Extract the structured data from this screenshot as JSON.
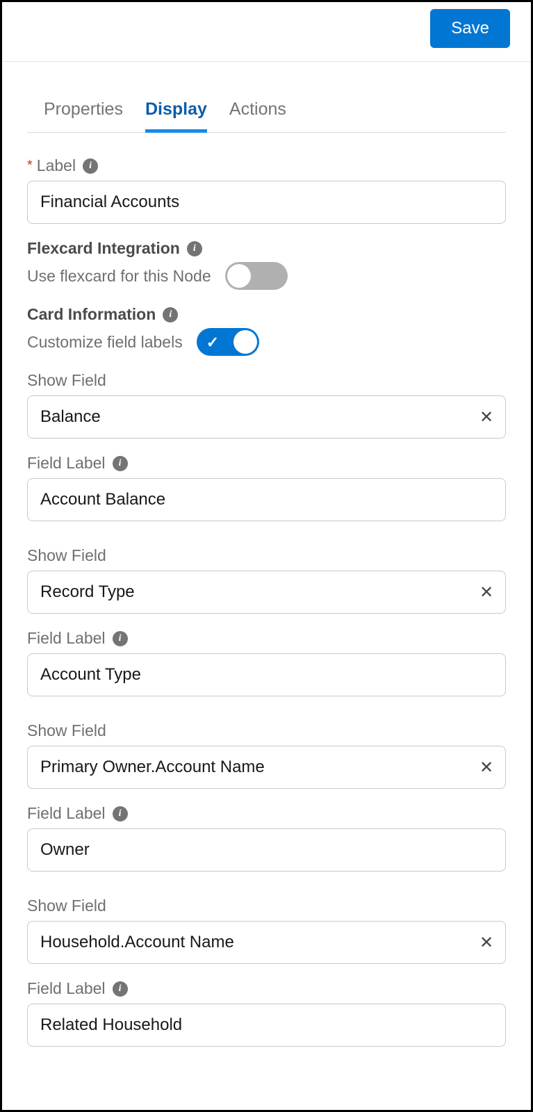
{
  "header": {
    "save": "Save"
  },
  "tabs": {
    "properties": "Properties",
    "display": "Display",
    "actions": "Actions"
  },
  "label": {
    "title": "Label",
    "value": "Financial Accounts"
  },
  "flexcard": {
    "section": "Flexcard Integration",
    "toggle_label": "Use flexcard for this Node"
  },
  "cardinfo": {
    "section": "Card Information",
    "toggle_label": "Customize field labels"
  },
  "fieldLabels": {
    "show_field": "Show Field",
    "field_label": "Field Label"
  },
  "pairs": [
    {
      "show": "Balance",
      "label": "Account Balance"
    },
    {
      "show": "Record Type",
      "label": "Account Type"
    },
    {
      "show": "Primary Owner.Account Name",
      "label": "Owner"
    },
    {
      "show": "Household.Account Name",
      "label": "Related Household"
    }
  ]
}
